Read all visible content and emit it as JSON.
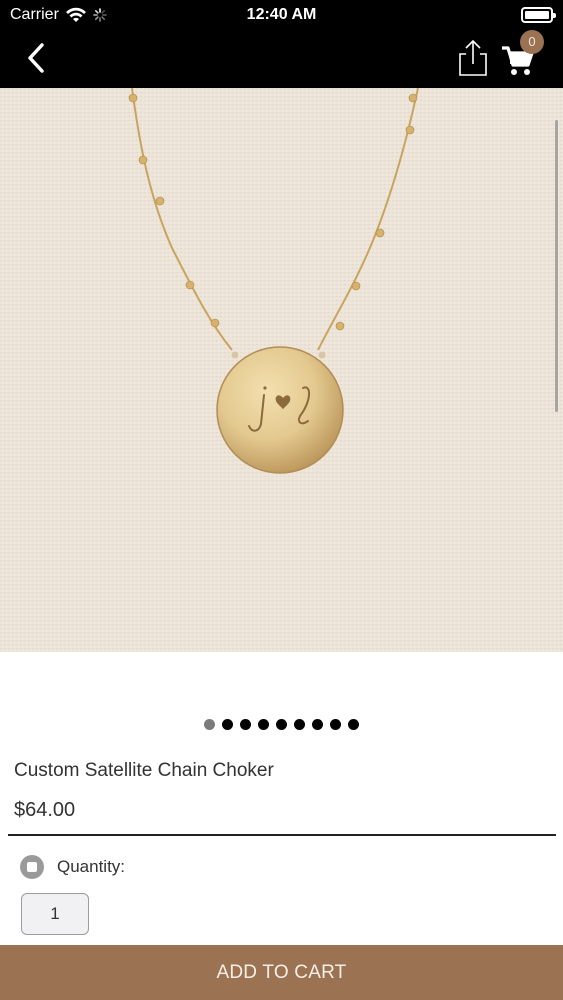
{
  "status_bar": {
    "carrier": "Carrier",
    "time": "12:40 AM",
    "icons": [
      "wifi-icon",
      "activity-spinner-icon",
      "battery-icon"
    ]
  },
  "nav": {
    "back_icon": "chevron-left-icon",
    "share_icon": "share-icon",
    "cart_icon": "shopping-cart-icon",
    "cart_count": "0"
  },
  "product": {
    "image_description": "gold disc choker engraved with j heart l",
    "title": "Custom Satellite Chain Choker",
    "price": "$64.00",
    "image_count": 9,
    "active_image": 1,
    "quantity_label": "Quantity:",
    "quantity_value": "1"
  },
  "actions": {
    "add_to_cart": "ADD TO CART"
  },
  "colors": {
    "brand": "#9b7252",
    "bar_background": "#000000",
    "page_background": "#ffffff"
  }
}
